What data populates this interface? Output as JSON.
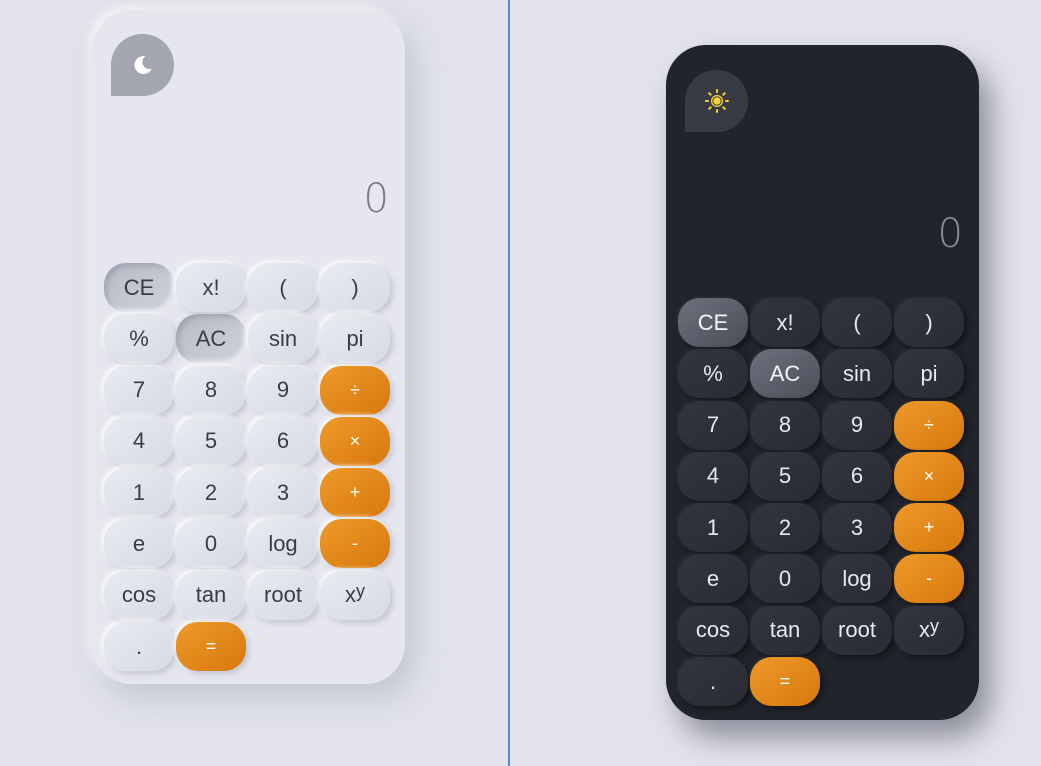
{
  "light": {
    "theme_icon": "moon-icon",
    "display": "0",
    "keys": [
      {
        "label": "CE",
        "style": "gray"
      },
      {
        "label": "x!",
        "style": "normal"
      },
      {
        "label": "(",
        "style": "normal"
      },
      {
        "label": ")",
        "style": "normal"
      },
      {
        "label": "%",
        "style": "normal"
      },
      {
        "label": "AC",
        "style": "gray"
      },
      {
        "label": "sin",
        "style": "normal"
      },
      {
        "label": "pi",
        "style": "normal"
      },
      {
        "label": "7",
        "style": "normal"
      },
      {
        "label": "8",
        "style": "normal"
      },
      {
        "label": "9",
        "style": "normal"
      },
      {
        "label": "÷",
        "style": "orange"
      },
      {
        "label": "4",
        "style": "normal"
      },
      {
        "label": "5",
        "style": "normal"
      },
      {
        "label": "6",
        "style": "normal"
      },
      {
        "label": "×",
        "style": "orange"
      },
      {
        "label": "1",
        "style": "normal"
      },
      {
        "label": "2",
        "style": "normal"
      },
      {
        "label": "3",
        "style": "normal"
      },
      {
        "label": "+",
        "style": "orange"
      },
      {
        "label": "e",
        "style": "normal"
      },
      {
        "label": "0",
        "style": "normal"
      },
      {
        "label": "log",
        "style": "normal"
      },
      {
        "label": "-",
        "style": "orange"
      },
      {
        "label": "cos",
        "style": "normal"
      },
      {
        "label": "tan",
        "style": "normal"
      },
      {
        "label": "root",
        "style": "normal"
      },
      {
        "label": "x",
        "sup": "y",
        "style": "normal"
      },
      {
        "label": ".",
        "style": "normal"
      },
      {
        "label": "=",
        "style": "orange"
      }
    ]
  },
  "dark": {
    "theme_icon": "sun-icon",
    "display": "0",
    "keys": [
      {
        "label": "CE",
        "style": "gray"
      },
      {
        "label": "x!",
        "style": "normal"
      },
      {
        "label": "(",
        "style": "normal"
      },
      {
        "label": ")",
        "style": "normal"
      },
      {
        "label": "%",
        "style": "normal"
      },
      {
        "label": "AC",
        "style": "gray"
      },
      {
        "label": "sin",
        "style": "normal"
      },
      {
        "label": "pi",
        "style": "normal"
      },
      {
        "label": "7",
        "style": "normal"
      },
      {
        "label": "8",
        "style": "normal"
      },
      {
        "label": "9",
        "style": "normal"
      },
      {
        "label": "÷",
        "style": "orange"
      },
      {
        "label": "4",
        "style": "normal"
      },
      {
        "label": "5",
        "style": "normal"
      },
      {
        "label": "6",
        "style": "normal"
      },
      {
        "label": "×",
        "style": "orange"
      },
      {
        "label": "1",
        "style": "normal"
      },
      {
        "label": "2",
        "style": "normal"
      },
      {
        "label": "3",
        "style": "normal"
      },
      {
        "label": "+",
        "style": "orange"
      },
      {
        "label": "e",
        "style": "normal"
      },
      {
        "label": "0",
        "style": "normal"
      },
      {
        "label": "log",
        "style": "normal"
      },
      {
        "label": "-",
        "style": "orange"
      },
      {
        "label": "cos",
        "style": "normal"
      },
      {
        "label": "tan",
        "style": "normal"
      },
      {
        "label": "root",
        "style": "normal"
      },
      {
        "label": "x",
        "sup": "y",
        "style": "normal"
      },
      {
        "label": ".",
        "style": "normal"
      },
      {
        "label": "=",
        "style": "orange"
      }
    ]
  },
  "colors": {
    "accent": "#e38714",
    "light_bg": "#e6e7ee",
    "dark_bg": "#22242c",
    "sun": "#f5d33a"
  }
}
